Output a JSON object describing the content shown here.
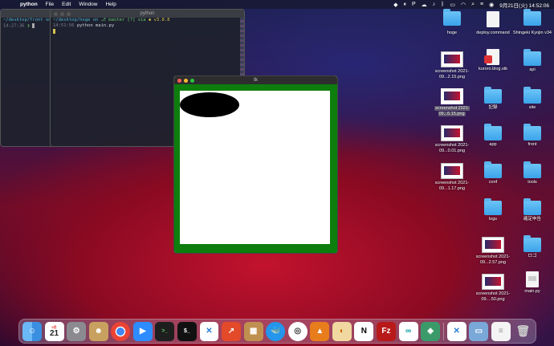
{
  "menubar": {
    "app_name": "python",
    "menus": [
      "File",
      "Edit",
      "Window",
      "Help"
    ],
    "datetime": "9月21日(火)  14:52:06",
    "status_icons": [
      "dropbox-icon",
      "pause-icon",
      "p-icon",
      "cloud-icon",
      "sound-icon",
      "bluetooth-icon",
      "battery-icon",
      "wifi-icon",
      "search-icon",
      "control-center-icon",
      "siri-icon"
    ]
  },
  "terminal_back": {
    "prompt_path": "~/desktop/front on",
    "time": "14:27:36",
    "prompt_char": "❯"
  },
  "terminal_front": {
    "title": "python",
    "prompt_path": "~/desktop/hoge on",
    "branch": "master [?] via",
    "version": "v3.8.8",
    "time": "14:51:56",
    "command": "python main.py"
  },
  "tk_window": {
    "title": "tk",
    "frame_color": "#0d7d0d",
    "canvas_color": "#ffffff",
    "oval_color": "#000000"
  },
  "desktop_icons": [
    {
      "label": "",
      "kind": "folder"
    },
    {
      "label": "",
      "kind": "doc"
    },
    {
      "label": "",
      "kind": "folder"
    },
    {
      "label": "hoge",
      "kind": "folder"
    },
    {
      "label": "deploy.command",
      "kind": "exec"
    },
    {
      "label": "Shingeki Kyojin v34",
      "kind": "folder"
    },
    {
      "label": "screenshot 2021-09...2.15.png",
      "kind": "shot"
    },
    {
      "label": "kuroro.blog.stk",
      "kind": "stk"
    },
    {
      "label": "api",
      "kind": "folder"
    },
    {
      "label": "screenshot 2021-09...6.15.png",
      "kind": "shot"
    },
    {
      "label": "記録",
      "kind": "folder"
    },
    {
      "label": "site",
      "kind": "folder"
    },
    {
      "label": "screenshot 2021-09...0.01.png",
      "kind": "shot"
    },
    {
      "label": "app",
      "kind": "folder"
    },
    {
      "label": "front",
      "kind": "folder"
    },
    {
      "label": "screenshot 2021-09...1.17.png",
      "kind": "shot"
    },
    {
      "label": "conf",
      "kind": "folder"
    },
    {
      "label": "tools",
      "kind": "folder"
    },
    {
      "label": "logs",
      "kind": "folder"
    },
    {
      "label": "確定申告",
      "kind": "folder"
    },
    {
      "label": "screenshot 2021-09...2.57.png",
      "kind": "shot"
    },
    {
      "label": "ロゴ",
      "kind": "folder"
    },
    {
      "label": "screenshot 2021-09....50.png",
      "kind": "shot"
    },
    {
      "label": "main.py",
      "kind": "py"
    }
  ],
  "dock": {
    "calendar_month": "9月",
    "calendar_day": "21",
    "apps": [
      "finder-icon",
      "calendar-icon",
      "system-preferences-icon",
      "contacts-icon",
      "chrome-icon",
      "zoom-icon",
      "terminal-icon",
      "iterm-icon",
      "vscode-icon",
      "git-icon",
      "app-icon",
      "docker-icon",
      "proxyman-icon",
      "sourcetree-icon",
      "app2-icon",
      "notion-icon",
      "filezilla-icon",
      "arduino-icon",
      "app3-icon",
      "vscode2-icon",
      "preview-icon",
      "document-icon",
      "trash-icon"
    ]
  }
}
